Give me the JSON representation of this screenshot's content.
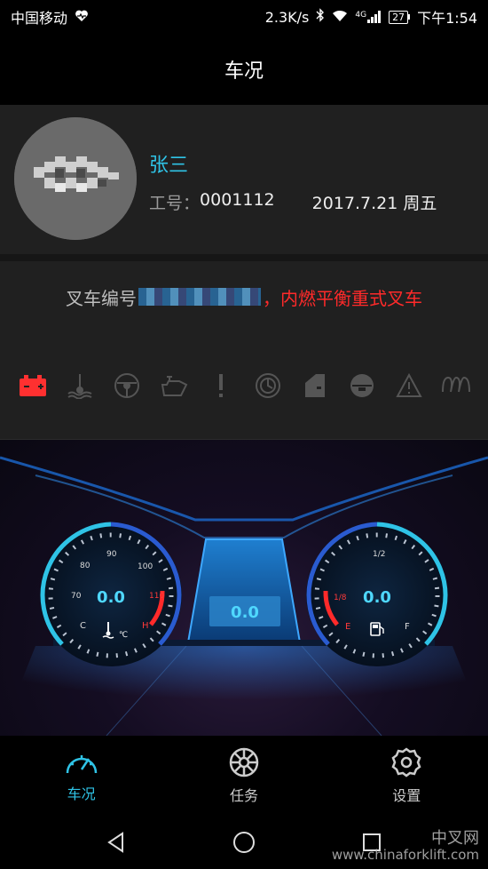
{
  "status_bar": {
    "carrier": "中国移动",
    "net_speed": "2.3K/s",
    "signal_type": "4G",
    "battery": "27",
    "time": "下午1:54"
  },
  "header": {
    "title": "车况"
  },
  "profile": {
    "name": "张三",
    "id_label": "工号：",
    "id_value": "0001112",
    "date": "2017.7.21 周五"
  },
  "forklift": {
    "label": "叉车编号",
    "type": "，内燃平衡重式叉车"
  },
  "warning_icons": [
    "battery-icon",
    "coolant-temp-icon",
    "steering-icon",
    "oil-pressure-icon",
    "exclamation-icon",
    "brake-icon",
    "door-icon",
    "tire-icon",
    "warning-triangle-icon",
    "glow-plug-icon"
  ],
  "gauges": {
    "left": {
      "value": "0.0",
      "ticks": [
        "70",
        "80",
        "90",
        "100",
        "110"
      ],
      "cold": "C",
      "hot": "H",
      "unit": "℃"
    },
    "center": {
      "value": "0.0"
    },
    "right": {
      "value": "0.0",
      "empty": "E",
      "quarter": "1/8",
      "half": "1/2",
      "full": "F"
    }
  },
  "tabs": [
    {
      "label": "车况",
      "icon": "speedometer-icon",
      "active": true
    },
    {
      "label": "任务",
      "icon": "wheel-icon",
      "active": false
    },
    {
      "label": "设置",
      "icon": "gear-icon",
      "active": false
    }
  ],
  "watermark": {
    "cn": "中叉网",
    "url": "www.chinaforklift.com"
  },
  "colors": {
    "accent": "#2fc3e6",
    "alert": "#ff2a2a"
  }
}
